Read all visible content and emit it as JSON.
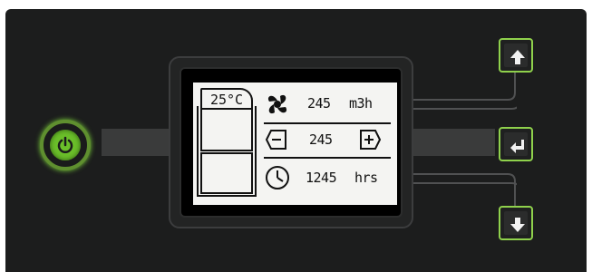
{
  "lcd": {
    "temperature": "25°C",
    "airflow_value": "245",
    "airflow_unit": "m3h",
    "setpoint_value": "245",
    "hours_value": "1245",
    "hours_unit": "hrs"
  },
  "colors": {
    "panel": "#1c1d1d",
    "accent_green": "#8fd14c",
    "lcd_background": "#f4f4f2"
  },
  "icons": {
    "power": "power-icon",
    "fan": "fan-icon",
    "decrease": "minus-arrow-icon",
    "increase": "plus-arrow-icon",
    "clock": "clock-icon",
    "up": "arrow-up-icon",
    "enter": "enter-icon",
    "down": "arrow-down-icon"
  }
}
